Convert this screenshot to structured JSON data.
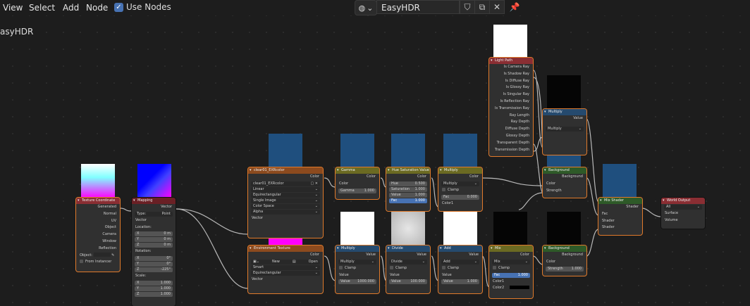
{
  "menu": {
    "view": "View",
    "select": "Select",
    "add": "Add",
    "node": "Node",
    "use_nodes": "Use Nodes"
  },
  "header": {
    "world_name": "EasyHDR",
    "title_partial": "asyHDR"
  },
  "nodes": {
    "tex_coord": {
      "title": "Texture Coordinate",
      "outputs": [
        "Generated",
        "Normal",
        "UV",
        "Object",
        "Camera",
        "Window",
        "Reflection"
      ],
      "object_label": "Object:",
      "from_instancer": "From Instancer"
    },
    "mapping": {
      "title": "Mapping",
      "out": "Vector",
      "type_label": "Type:",
      "type_value": "Point",
      "vector": "Vector",
      "location": "Location:",
      "rotation": "Rotation:",
      "scale": "Scale:",
      "loc": [
        [
          "X",
          "0 m"
        ],
        [
          "Y",
          "0 m"
        ],
        [
          "Z",
          "0 m"
        ]
      ],
      "rot": [
        [
          "X",
          "0°"
        ],
        [
          "Y",
          "0°"
        ],
        [
          "Z",
          "-225°"
        ]
      ],
      "scl": [
        [
          "X",
          "1.000"
        ],
        [
          "Y",
          "1.000"
        ],
        [
          "Z",
          "1.000"
        ]
      ]
    },
    "image_tex": {
      "title": "clear01_EXRcolor",
      "color": "Color",
      "file": "clear01_EXRcolor",
      "interp": "Linear",
      "proj": "Equirectangular",
      "source": "Single Image",
      "color_space": "Color Space",
      "alpha": "Alpha",
      "vector": "Vector"
    },
    "env_tex": {
      "title": "Environment Texture",
      "color": "Color",
      "new": "New",
      "open": "Open",
      "interp": "Smart",
      "proj": "Equirectangular",
      "vector": "Vector"
    },
    "gamma": {
      "title": "Gamma",
      "out": "Color",
      "color": "Color",
      "gamma_label": "Gamma",
      "gamma_value": "1.000"
    },
    "hsv": {
      "title": "Hue Saturation Value",
      "out": "Color",
      "hue": "Hue",
      "hue_v": "0.500",
      "sat": "Saturation",
      "sat_v": "1.000",
      "val": "Value",
      "val_v": "1.000",
      "fac": "Fac",
      "fac_v": "1.000"
    },
    "multiply_color": {
      "title": "Multiply",
      "out": "Color",
      "mode": "Multiply",
      "clamp": "Clamp",
      "fac": "Fac",
      "fac_v": "0.000",
      "color1": "Color1"
    },
    "multiply1": {
      "title": "Multiply",
      "out": "Value",
      "mode": "Multiply",
      "clamp": "Clamp",
      "value": "Value",
      "value_label": "Value",
      "value_v": "1000.000"
    },
    "divide": {
      "title": "Divide",
      "out": "Value",
      "mode": "Divide",
      "clamp": "Clamp",
      "value": "Value",
      "value_label": "Value",
      "value_v": "100.000"
    },
    "add": {
      "title": "Add",
      "out": "Value",
      "mode": "Add",
      "clamp": "Clamp",
      "value": "Value",
      "value_label": "Value",
      "value_v": "1.000"
    },
    "mix": {
      "title": "Mix",
      "out": "Color",
      "mode": "Mix",
      "clamp": "Clamp",
      "fac": "Fac",
      "fac_v": "1.000",
      "color1": "Color1",
      "color2": "Color2"
    },
    "light_path": {
      "title": "Light Path",
      "outputs": [
        "Is Camera Ray",
        "Is Shadow Ray",
        "Is Diffuse Ray",
        "Is Glossy Ray",
        "Is Singular Ray",
        "Is Reflection Ray",
        "Is Transmission Ray",
        "Ray Length",
        "Ray Depth",
        "Diffuse Depth",
        "Glossy Depth",
        "Transparent Depth",
        "Transmission Depth"
      ]
    },
    "multiply2": {
      "title": "Multiply",
      "out": "Value",
      "mode": "Multiply"
    },
    "background1": {
      "title": "Background",
      "out": "Background",
      "color": "Color",
      "strength": "Strength"
    },
    "background2": {
      "title": "Background",
      "out": "Background",
      "color": "Color",
      "strength_label": "Strength",
      "strength_v": "1.000"
    },
    "mix_shader": {
      "title": "Mix Shader",
      "out": "Shader",
      "fac": "Fac",
      "shader1": "Shader",
      "shader2": "Shader"
    },
    "world_output": {
      "title": "World Output",
      "target": "All",
      "surface": "Surface",
      "volume": "Volume"
    }
  },
  "colors": {
    "accent": "#4772b3",
    "selected_outline": "#e07a2b",
    "socket_yellow": "#c7c729",
    "socket_gray": "#a1a1a1",
    "socket_purple": "#6363c7",
    "socket_green": "#63c763"
  }
}
